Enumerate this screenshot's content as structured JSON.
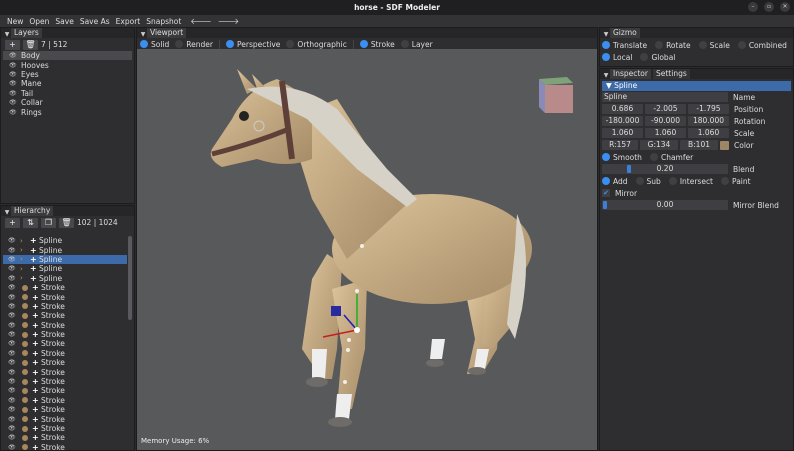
{
  "window": {
    "title": "horse - SDF Modeler",
    "minimize": "–",
    "maximize": "▫",
    "close": "✕"
  },
  "menu": [
    "New",
    "Open",
    "Save",
    "Save As",
    "Export",
    "Snapshot"
  ],
  "nav": {
    "back": "🡐",
    "forward": "🡒"
  },
  "layers": {
    "tab": "Layers",
    "count": "7 | 512",
    "items": [
      "Body",
      "Hooves",
      "Eyes",
      "Mane",
      "Tail",
      "Collar",
      "Rings"
    ],
    "selected": 0
  },
  "hierarchy": {
    "tab": "Hierarchy",
    "count": "102 | 1024",
    "splines": [
      "Spline",
      "Spline",
      "Spline",
      "Spline",
      "Spline"
    ],
    "selected": 2,
    "stroke_label": "Stroke",
    "stroke_color": "#a8875a"
  },
  "viewport": {
    "tab": "Viewport",
    "modes": [
      "Solid",
      "Render"
    ],
    "projections": [
      "Perspective",
      "Orthographic"
    ],
    "display": [
      "Stroke",
      "Layer"
    ],
    "memory": "Memory Usage: 6%"
  },
  "gizmo": {
    "tab": "Gizmo",
    "modes": [
      "Translate",
      "Rotate",
      "Scale",
      "Combined"
    ],
    "spaces": [
      "Local",
      "Global"
    ]
  },
  "inspector": {
    "tabs": [
      "Inspector",
      "Settings"
    ],
    "header": "Spline",
    "name": "Spline",
    "name_label": "Name",
    "position": [
      "0.686",
      "-2.005",
      "-1.795"
    ],
    "position_label": "Position",
    "rotation": [
      "-180.000",
      "-90.000",
      "180.000"
    ],
    "rotation_label": "Rotation",
    "scale": [
      "1.060",
      "1.060",
      "1.060"
    ],
    "scale_label": "Scale",
    "color": [
      "R:157",
      "G:134",
      "B:101"
    ],
    "color_label": "Color",
    "swatch": "#9d8665",
    "blend_modes": [
      "Smooth",
      "Chamfer"
    ],
    "blend": "0.20",
    "blend_label": "Blend",
    "blend_fraction": 0.2,
    "ops": [
      "Add",
      "Sub",
      "Intersect",
      "Paint"
    ],
    "mirror": "Mirror",
    "mirror_blend": "0.00",
    "mirror_blend_label": "Mirror Blend"
  }
}
